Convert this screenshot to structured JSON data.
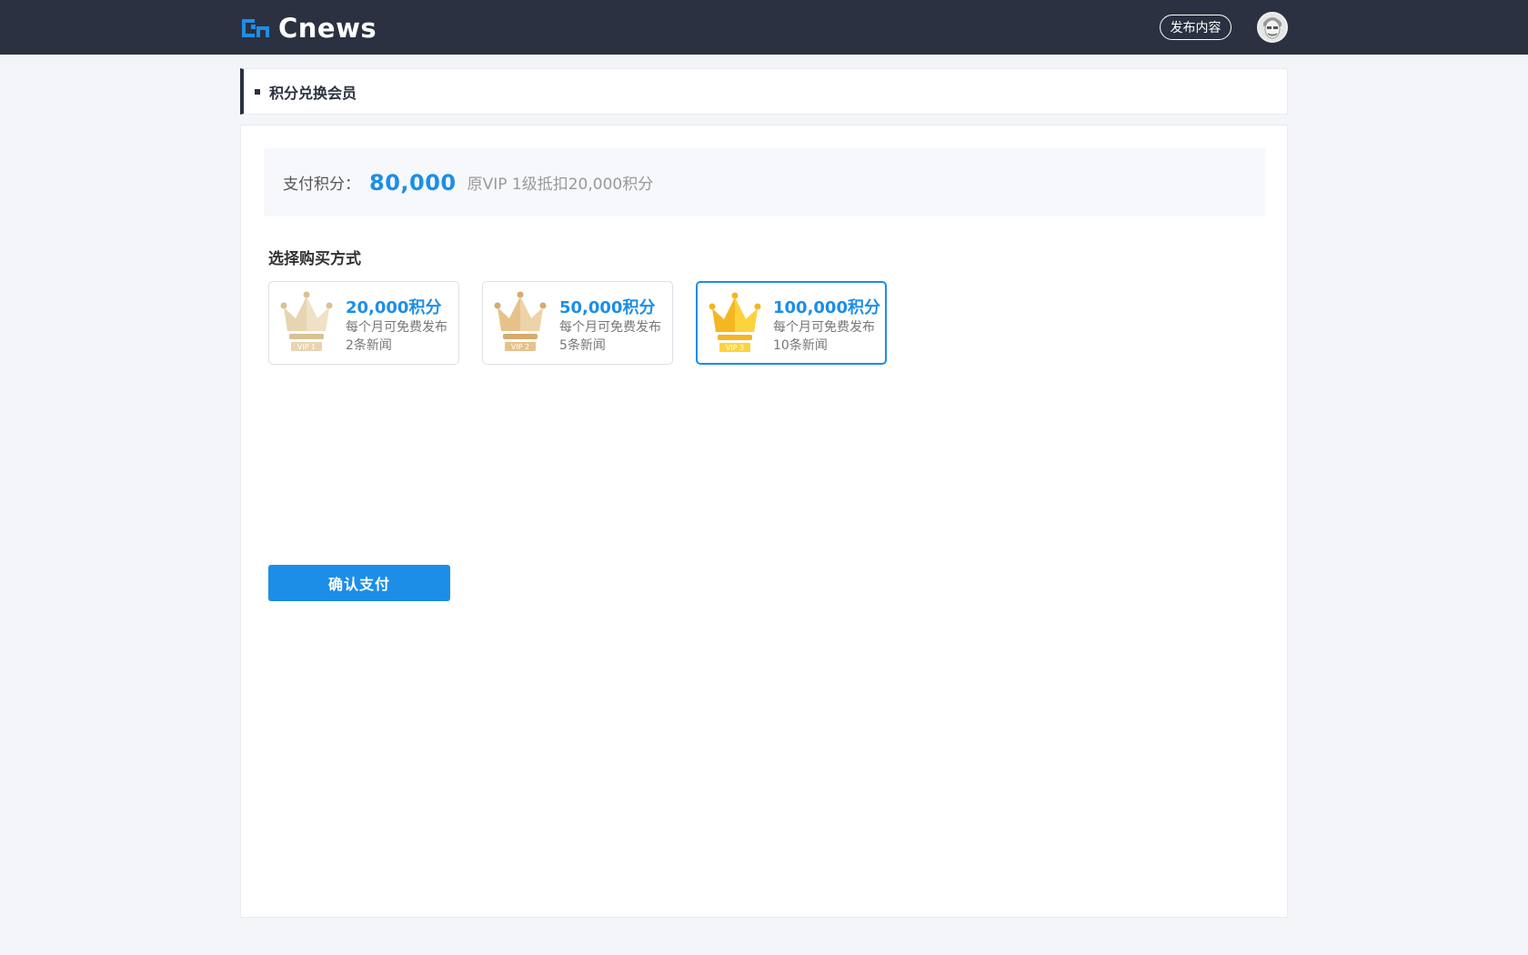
{
  "header": {
    "brand": "Cnews",
    "publish_label": "发布内容"
  },
  "page": {
    "title": "积分兑换会员"
  },
  "payment": {
    "label": "支付积分：",
    "amount": "80,000",
    "note": "原VIP 1级抵扣20,000积分"
  },
  "purchase": {
    "section_title": "选择购买方式",
    "options": [
      {
        "badge": "VIP 1",
        "points": "20,000积分",
        "desc": "每个月可免费发布2条新闻",
        "crown_colors": [
          "#e7d4b0",
          "#d8c193"
        ]
      },
      {
        "badge": "VIP 2",
        "points": "50,000积分",
        "desc": "每个月可免费发布5条新闻",
        "crown_colors": [
          "#e6c28a",
          "#d6ab6c"
        ]
      },
      {
        "badge": "VIP 3",
        "points": "100,000积分",
        "desc": "每个月可免费发布10条新闻",
        "crown_colors": [
          "#fcd33b",
          "#f4b621"
        ]
      }
    ],
    "selected_index": 2
  },
  "confirm_label": "确认支付",
  "colors": {
    "accent": "#1c8ee8",
    "header_bg": "#2b3140"
  }
}
